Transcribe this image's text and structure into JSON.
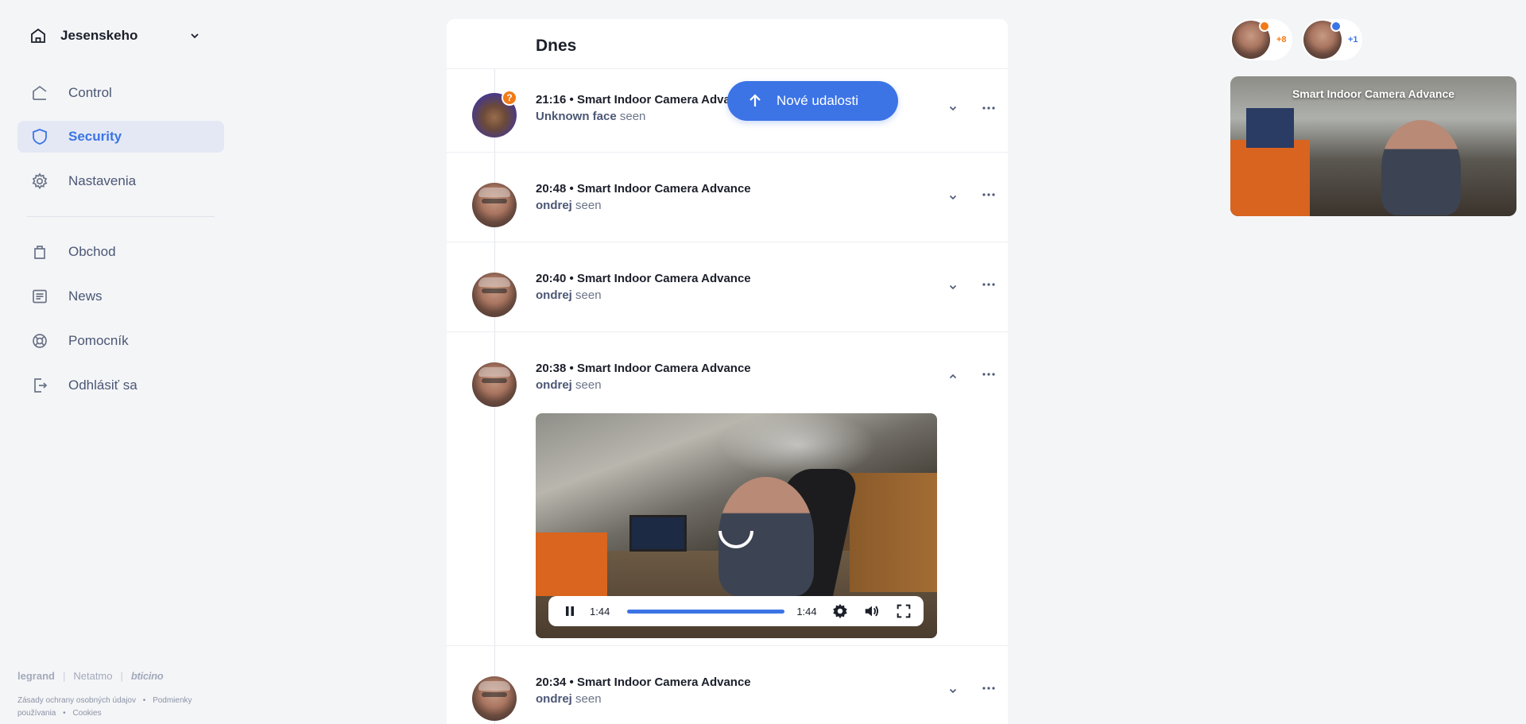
{
  "home": {
    "name": "Jesenskeho"
  },
  "nav": {
    "items": [
      {
        "label": "Control"
      },
      {
        "label": "Security"
      },
      {
        "label": "Nastavenia"
      },
      {
        "label": "Obchod"
      },
      {
        "label": "News"
      },
      {
        "label": "Pomocník"
      },
      {
        "label": "Odhlásiť sa"
      }
    ],
    "active": "Security"
  },
  "brands": {
    "legrand": "legrand",
    "netatmo": "Netatmo",
    "bticino": "bticino"
  },
  "footer": {
    "privacy": "Zásady ochrany osobných údajov",
    "terms": "Podmienky používania",
    "cookies": "Cookies",
    "bullet": "•"
  },
  "feed": {
    "title": "Dnes",
    "new_events_label": "Nové udalosti",
    "events": [
      {
        "time": "21:16",
        "camera": "Smart Indoor Camera Advance",
        "who": "Unknown face",
        "verb": "seen",
        "badge": "?"
      },
      {
        "time": "20:48",
        "camera": "Smart Indoor Camera Advance",
        "who": "ondrej",
        "verb": "seen"
      },
      {
        "time": "20:40",
        "camera": "Smart Indoor Camera Advance",
        "who": "ondrej",
        "verb": "seen"
      },
      {
        "time": "20:38",
        "camera": "Smart Indoor Camera Advance",
        "who": "ondrej",
        "verb": "seen",
        "expanded": true
      },
      {
        "time": "20:34",
        "camera": "Smart Indoor Camera Advance",
        "who": "ondrej",
        "verb": "seen"
      }
    ],
    "player": {
      "current": "1:44",
      "duration": "1:44",
      "progress": 1.0
    }
  },
  "people": [
    {
      "count": "+8",
      "color": "#f27a17"
    },
    {
      "count": "+1",
      "color": "#3c74e6"
    }
  ],
  "camera_card": {
    "title": "Smart Indoor Camera Advance"
  },
  "colors": {
    "accent": "#3c74e6",
    "sidebar_active_bg": "#e3e8f4",
    "orange": "#f27a17"
  }
}
